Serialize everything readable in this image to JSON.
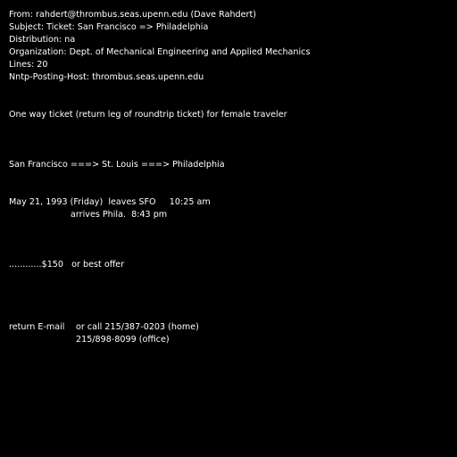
{
  "header": {
    "from": "From: rahdert@thrombus.seas.upenn.edu (Dave Rahdert)",
    "subject": "Subject: Ticket: San Francisco => Philadelphia",
    "distribution": "Distribution: na",
    "organization": "Organization: Dept. of Mechanical Engineering and Applied Mechanics",
    "lines": "Lines: 20",
    "nntp_host": "Nntp-Posting-Host: thrombus.seas.upenn.edu"
  },
  "body": {
    "intro": "One way ticket (return leg of roundtrip ticket) for female traveler",
    "route": "San Francisco ===> St. Louis ===> Philadelphia",
    "departure": "May 21, 1993 (Friday)  leaves SFO     10:25 am",
    "arrival": "arrives Phila.  8:43 pm",
    "price": "............$150   or best offer",
    "contact_label": "return E-mail",
    "contact_phone_home": "or call 215/387-0203 (home)",
    "contact_phone_office": "215/898-8099 (office)"
  }
}
